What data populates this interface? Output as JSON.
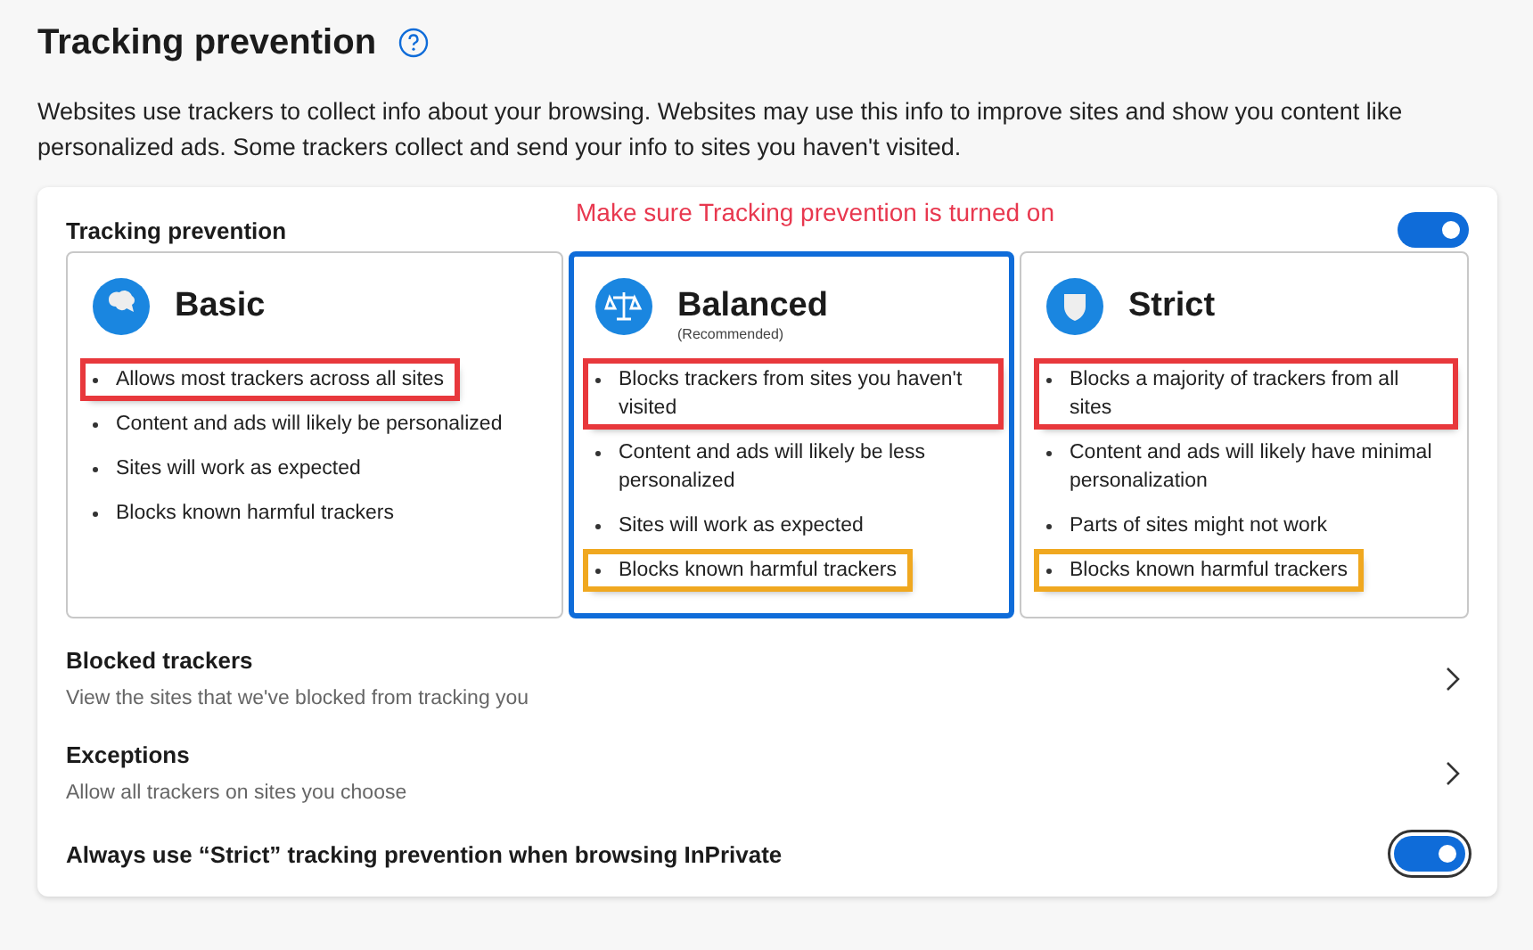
{
  "page": {
    "title": "Tracking prevention",
    "description": "Websites use trackers to collect info about your browsing. Websites may use this info to improve sites and show you content like personalized ads. Some trackers collect and send your info to sites you haven't visited."
  },
  "panel": {
    "label": "Tracking prevention",
    "annotation": "Make sure Tracking prevention is turned on",
    "on": true
  },
  "levels": [
    {
      "kind": "basic",
      "title": "Basic",
      "selected": false,
      "bullets": [
        {
          "text": "Allows most trackers across all sites",
          "color": "#e8383c"
        },
        {
          "text": "Content and ads will likely be personalized"
        },
        {
          "text": "Sites will work as expected"
        },
        {
          "text": "Blocks known harmful trackers"
        }
      ]
    },
    {
      "kind": "balanced",
      "title": "Balanced",
      "subtitle": "(Recommended)",
      "selected": true,
      "bullets": [
        {
          "text": "Blocks trackers from sites you haven't visited",
          "color": "#e8383c"
        },
        {
          "text": "Content and ads will likely be less personalized"
        },
        {
          "text": "Sites will work as expected"
        },
        {
          "text": "Blocks known harmful trackers",
          "color": "#f0a820"
        }
      ]
    },
    {
      "kind": "strict",
      "title": "Strict",
      "selected": false,
      "bullets": [
        {
          "text": "Blocks a majority of trackers from all sites",
          "color": "#e8383c"
        },
        {
          "text": "Content and ads will likely have minimal personalization"
        },
        {
          "text": "Parts of sites might not work"
        },
        {
          "text": "Blocks known harmful trackers",
          "color": "#f0a820"
        }
      ]
    }
  ],
  "links": [
    {
      "title": "Blocked trackers",
      "description": "View the sites that we've blocked from tracking you"
    },
    {
      "title": "Exceptions",
      "description": "Allow all trackers on sites you choose"
    }
  ],
  "inprivate": {
    "label": "Always use “Strict” tracking prevention when browsing InPrivate",
    "on": true,
    "focused": true
  }
}
